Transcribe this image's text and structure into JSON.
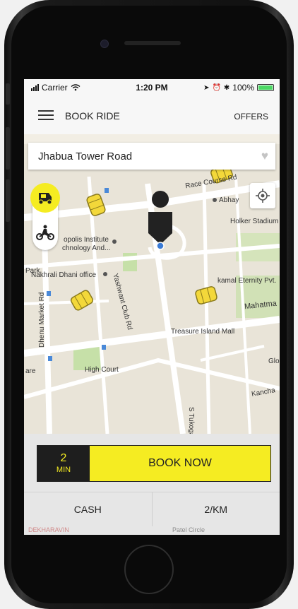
{
  "status_bar": {
    "carrier": "Carrier",
    "time": "1:20 PM",
    "battery": "100%",
    "wifi_icon": "wifi-icon",
    "signal_icon": "signal-icon"
  },
  "header": {
    "menu_icon": "hamburger-icon",
    "title": "BOOK RIDE",
    "offers_label": "OFFERS"
  },
  "search": {
    "location": "Jhabua Tower Road",
    "favorite_icon": "heart-icon"
  },
  "vehicle_selector": {
    "options": [
      "auto-rickshaw-icon",
      "bike-icon"
    ],
    "selected": "auto-rickshaw-icon",
    "accent": "#f5ec22"
  },
  "map": {
    "labels": {
      "race_course_rd": "Race Course Rd",
      "abhay": "Abhay",
      "holker_stadium": "Holker Stadium",
      "opolis_institute": "opolis Institute",
      "technology_and": "chnology And...",
      "nakhrali_dhani": "Nakhrali Dhani office",
      "yashwant_club_rd": "Yashwant Club Rd",
      "kamal_eternity": "kamal Eternity Pvt.",
      "park": "Park",
      "dhenu_market_rd": "Dhenu Market Rd",
      "mahatma": "Mahatma",
      "treasure_island_mall": "Treasure Island Mall",
      "high_court": "High Court",
      "are": "are",
      "glo": "Glo",
      "kancha": "Kancha",
      "s_tukoganj": "S Tukoga"
    }
  },
  "booking": {
    "eta_value": "2",
    "eta_unit": "MIN",
    "book_label": "BOOK NOW",
    "payment_label": "CASH",
    "fare_label": "2/KM",
    "accent": "#f5ec22",
    "dark": "#1e1e1e"
  },
  "peek": {
    "left_text": "DEKHARAVIN",
    "right_text": "Patel Circle"
  }
}
